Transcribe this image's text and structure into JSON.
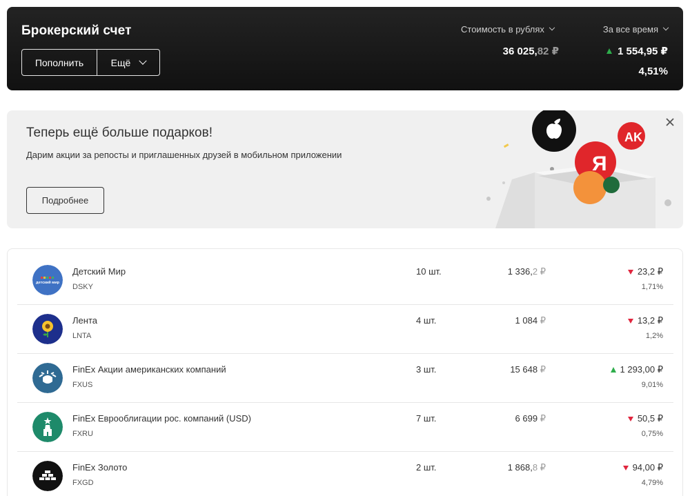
{
  "header": {
    "title": "Брокерский счет",
    "topup_label": "Пополнить",
    "more_label": "Ещё",
    "valuation_dropdown": "Стоимость в рублях",
    "period_dropdown": "За все время",
    "total_int": "36 025,",
    "total_frac": "82",
    "total_currency": "₽",
    "gain": "1 554,95 ₽",
    "gain_pct": "4,51%",
    "gain_direction": "up"
  },
  "promo": {
    "title": "Теперь ещё больше подарков!",
    "description": "Дарим акции за репосты и приглашенных друзей в мобильном приложении",
    "button_label": "Подробнее",
    "illustration": "gift-box-with-stock-logos"
  },
  "holdings": [
    {
      "name": "Детский Мир",
      "ticker": "DSKY",
      "qty": "10 шт.",
      "value_int": "1 336,",
      "value_frac": "2",
      "currency": "₽",
      "change": "23,2 ₽",
      "pct": "1,71%",
      "direction": "down",
      "logo_label": "детский мир",
      "logo_color": "#3f72c4",
      "icon": "detsky-mir-logo"
    },
    {
      "name": "Лента",
      "ticker": "LNTA",
      "qty": "4 шт.",
      "value_int": "1 084",
      "value_frac": "",
      "currency": "₽",
      "change": "13,2 ₽",
      "pct": "1,2%",
      "direction": "down",
      "logo_label": "",
      "logo_color": "#1d2f8c",
      "icon": "lenta-sunflower-logo"
    },
    {
      "name": "FinEx Акции американских компаний",
      "ticker": "FXUS",
      "qty": "3 шт.",
      "value_int": "15 648",
      "value_frac": "",
      "currency": "₽",
      "change": "1 293,00 ₽",
      "pct": "9,01%",
      "direction": "up",
      "logo_label": "",
      "logo_color": "#2f6a93",
      "icon": "statue-of-liberty-logo"
    },
    {
      "name": "FinEx Еврооблигации рос. компаний (USD)",
      "ticker": "FXRU",
      "qty": "7 шт.",
      "value_int": "6 699",
      "value_frac": "",
      "currency": "₽",
      "change": "50,5 ₽",
      "pct": "0,75%",
      "direction": "down",
      "logo_label": "",
      "logo_color": "#1e8a6a",
      "icon": "kremlin-tower-logo"
    },
    {
      "name": "FinEx Золото",
      "ticker": "FXGD",
      "qty": "2 шт.",
      "value_int": "1 868,",
      "value_frac": "8",
      "currency": "₽",
      "change": "94,00 ₽",
      "pct": "4,79%",
      "direction": "down",
      "logo_label": "",
      "logo_color": "#111111",
      "icon": "gold-bars-logo"
    }
  ],
  "colors": {
    "up": "#2ead4b",
    "down": "#e0263e",
    "header_bg": "#1a1a1a",
    "promo_bg": "#f0f0f0"
  }
}
